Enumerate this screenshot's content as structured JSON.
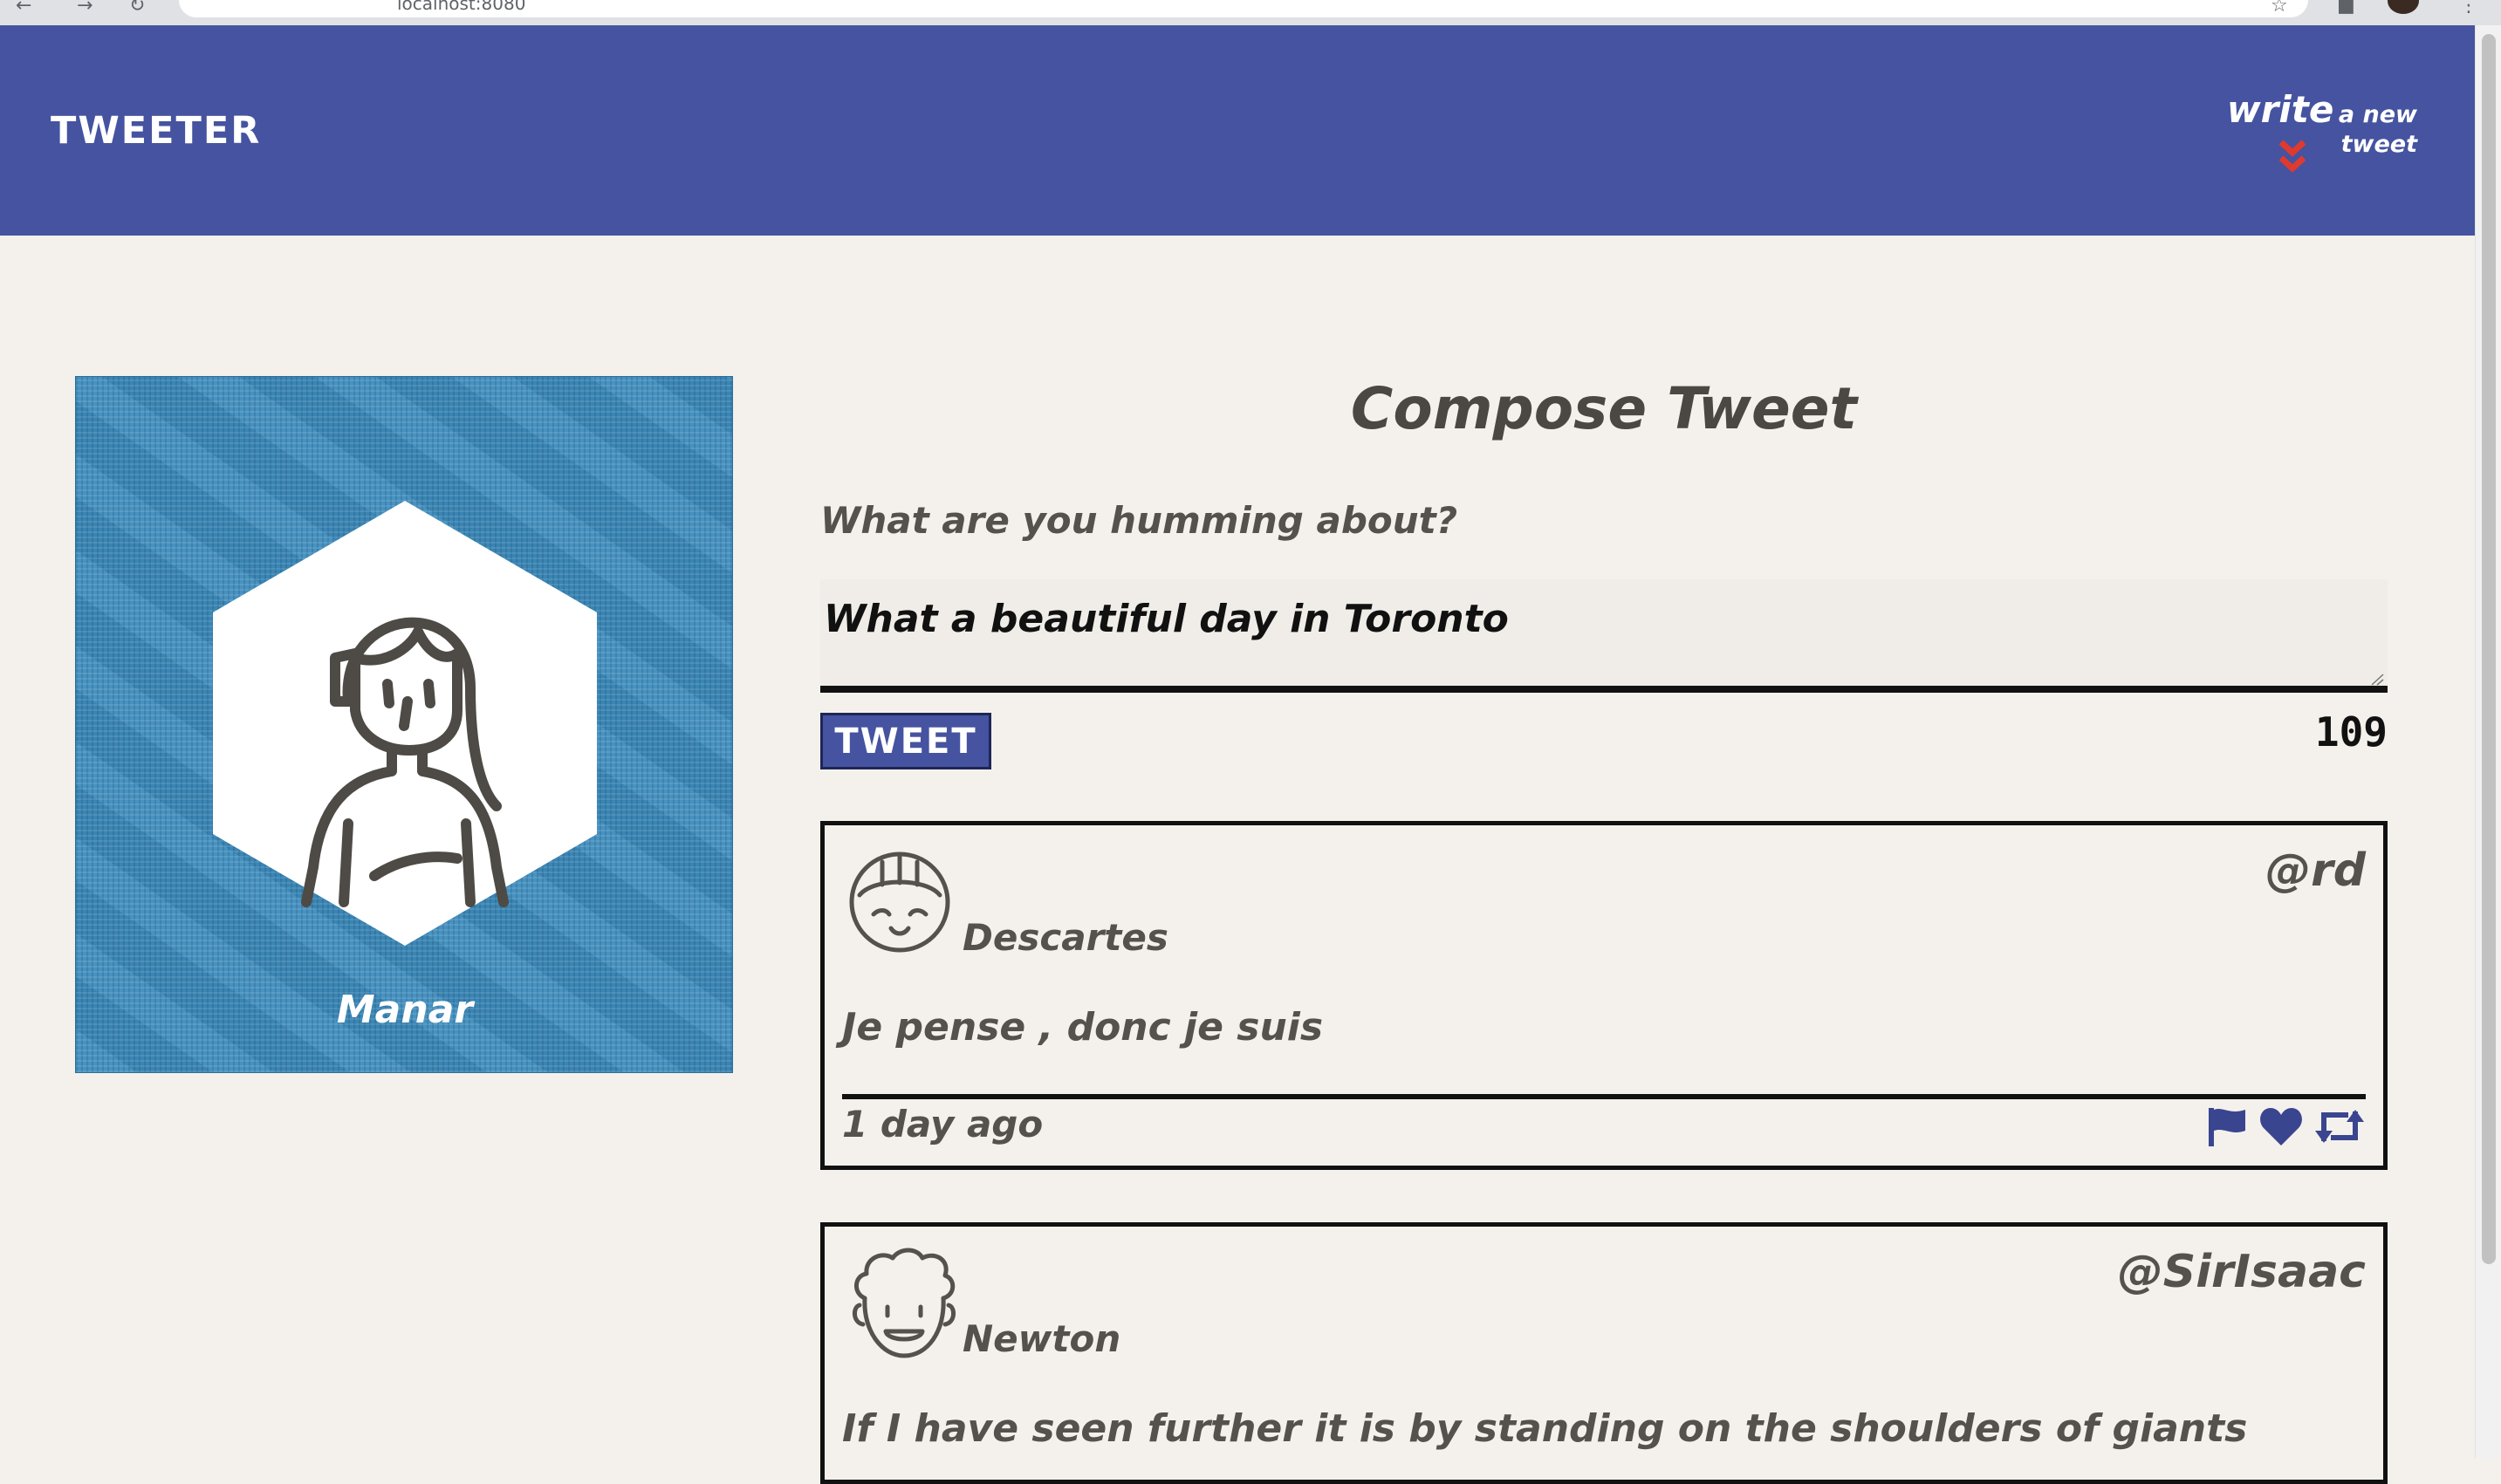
{
  "browser": {
    "url": "localhost:8080"
  },
  "header": {
    "brand": "TWEETER",
    "write_big": "write",
    "write_small": "a new tweet",
    "chevron_icon": "double-chevron-down-icon"
  },
  "profile": {
    "name": "Manar",
    "avatar_icon": "girl-avatar-icon"
  },
  "compose": {
    "title": "Compose Tweet",
    "label": "What are you humming about?",
    "input_value": "What a beautiful day in Toronto",
    "button_label": "TWEET",
    "counter": "109"
  },
  "tweets": [
    {
      "name": "Descartes",
      "handle": "@rd",
      "content": "Je pense , donc je suis",
      "time": "1 day ago",
      "avatar_icon": "bangs-avatar-icon",
      "actions": [
        "flag-icon",
        "heart-icon",
        "retweet-icon"
      ]
    },
    {
      "name": "Newton",
      "handle": "@SirIsaac",
      "content": "If I have seen further it is by standing on the shoulders of giants",
      "avatar_icon": "curly-hair-avatar-icon"
    }
  ],
  "colors": {
    "navbar": "#4553a0",
    "page_background": "#f4f1ec",
    "chevron": "#e03a2f",
    "action_icons": "#3a4590"
  }
}
